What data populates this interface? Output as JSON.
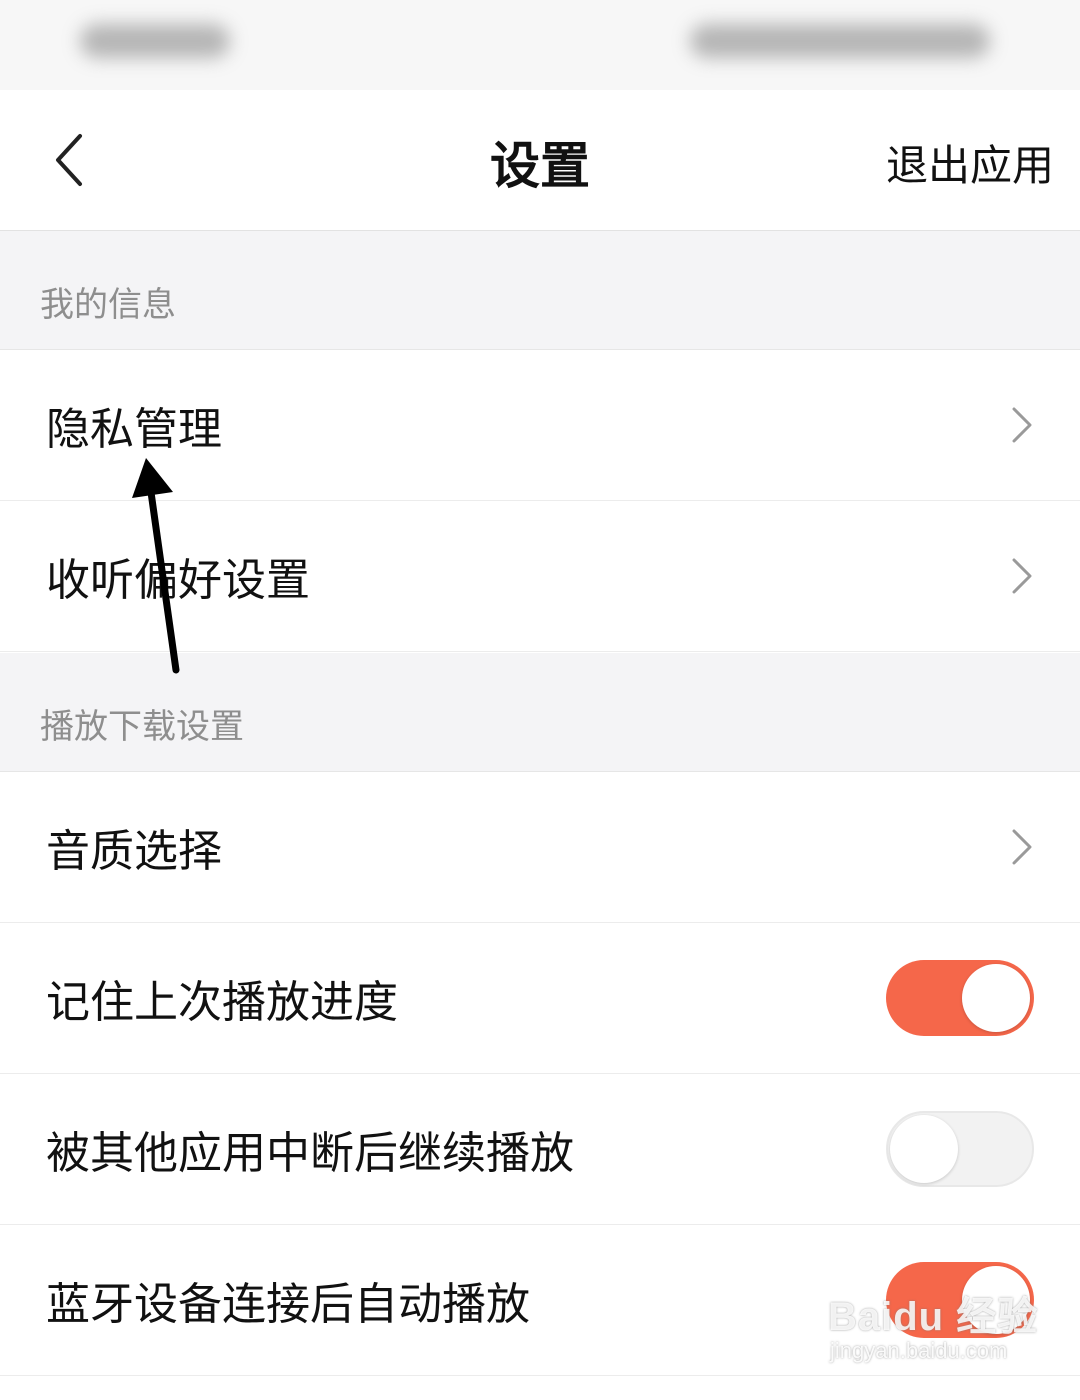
{
  "nav": {
    "title": "设置",
    "exit_label": "退出应用"
  },
  "sections": [
    {
      "header": "我的信息",
      "items": [
        {
          "label": "隐私管理",
          "control": "chevron"
        },
        {
          "label": "收听偏好设置",
          "control": "chevron"
        }
      ]
    },
    {
      "header": "播放下载设置",
      "items": [
        {
          "label": "音质选择",
          "control": "chevron"
        },
        {
          "label": "记住上次播放进度",
          "control": "toggle",
          "on": true
        },
        {
          "label": "被其他应用中断后继续播放",
          "control": "toggle",
          "on": false
        },
        {
          "label": "蓝牙设备连接后自动播放",
          "control": "toggle",
          "on": true
        }
      ]
    }
  ],
  "watermark": {
    "text": "Baidu 经验",
    "sub": "jingyan.baidu.com"
  },
  "colors": {
    "toggle_on": "#f5674a",
    "toggle_off": "#f2f2f2",
    "section_bg": "#f4f4f6",
    "section_text": "#8e8e8e"
  },
  "icons": {
    "back": "chevron-left-icon",
    "row_chevron": "chevron-right-icon",
    "annotation": "arrow-up-icon"
  }
}
